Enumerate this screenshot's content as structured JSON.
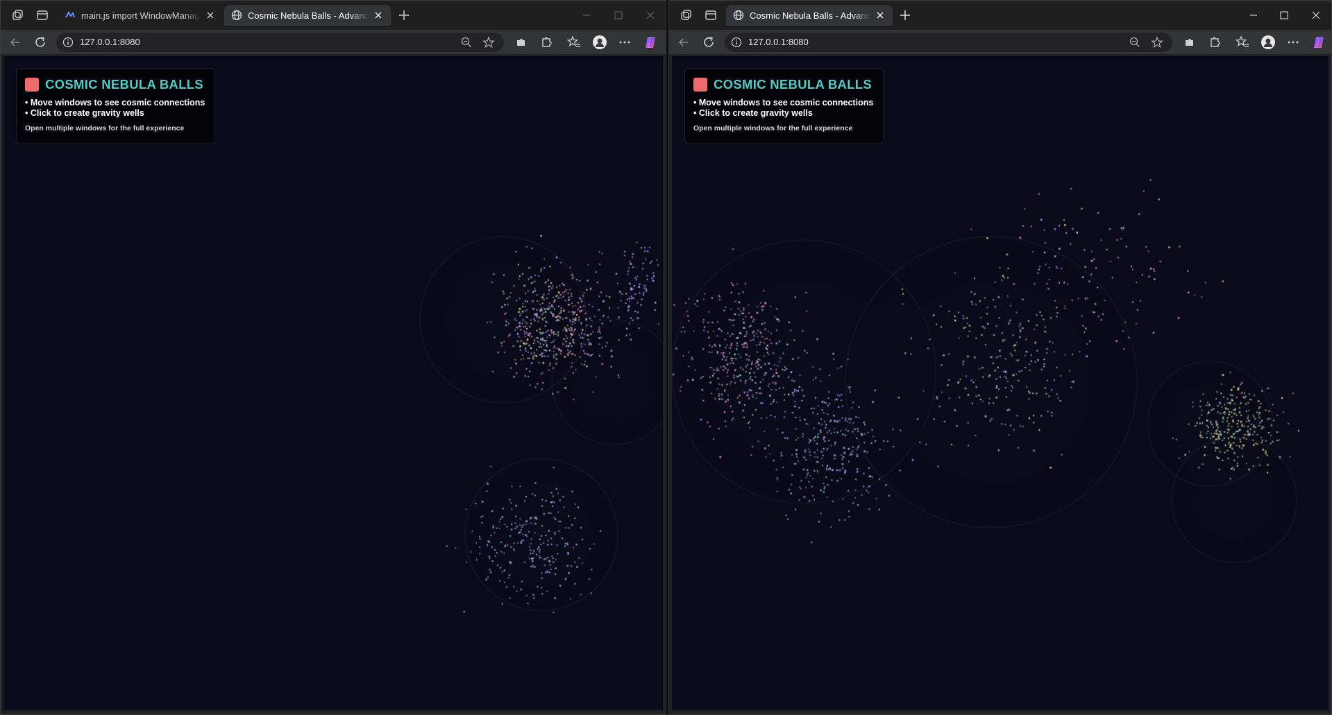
{
  "windows": [
    {
      "tabs": [
        {
          "label": "main.js import WindowManager f",
          "active": false
        },
        {
          "label": "Cosmic Nebula Balls - Advanced I",
          "active": true
        }
      ],
      "url": "127.0.0.1:8080"
    },
    {
      "tabs": [
        {
          "label": "Cosmic Nebula Balls - Advanced I",
          "active": true
        }
      ],
      "url": "127.0.0.1:8080"
    }
  ],
  "panel": {
    "title": "COSMIC NEBULA BALLS",
    "line1": "• Move windows to see cosmic connections",
    "line2": "• Click to create gravity wells",
    "footer": "Open multiple windows for the full experience"
  },
  "colors": {
    "background": "#0a0a1a",
    "title_accent": "#4ecdc4",
    "logo_square": "#ee6b6b",
    "particle_palette": [
      "#f48fb1",
      "#9fa8ff",
      "#80cbc4",
      "#a5d6a7",
      "#e6d28a",
      "#c5a3ff"
    ]
  },
  "icons": [
    "workspaces-icon",
    "vertical-tabs-icon",
    "globe-icon",
    "close-icon",
    "new-tab-icon",
    "back-icon",
    "refresh-icon",
    "info-icon",
    "zoom-icon",
    "favorite-star-icon",
    "extensions-icon",
    "favorites-icon",
    "profile-avatar-icon",
    "more-icon",
    "copilot-icon"
  ]
}
